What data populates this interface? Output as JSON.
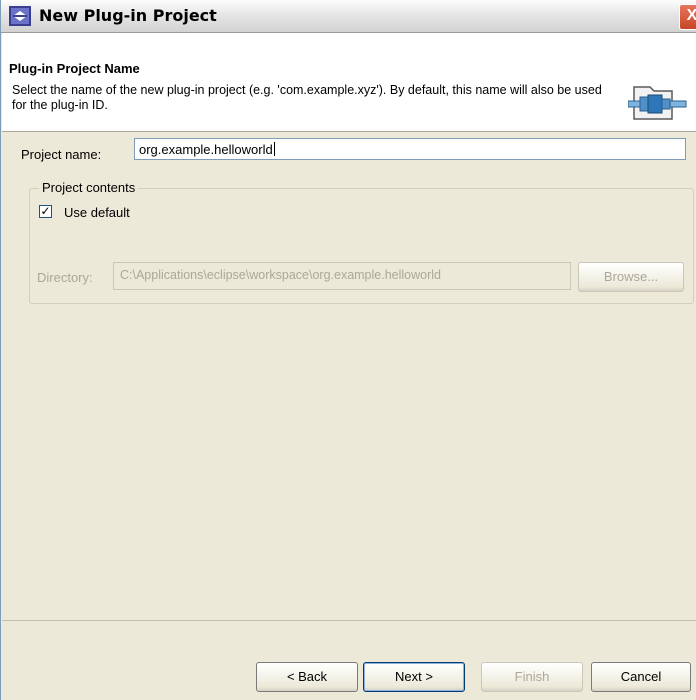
{
  "window": {
    "title": "New Plug-in Project",
    "close_symbol": "X"
  },
  "header": {
    "title": "Plug-in Project Name",
    "description": "Select the name of the new plug-in project (e.g. 'com.example.xyz'). By default, this name will also be used for the plug-in ID.",
    "icon": "plugin-project-wizard-icon"
  },
  "project_name": {
    "label": "Project name:",
    "value": "org.example.helloworld"
  },
  "project_contents": {
    "group_title": "Project contents",
    "use_default_label": "Use default",
    "use_default_checked": true,
    "directory_label": "Directory:",
    "directory_value": "C:\\Applications\\eclipse\\workspace\\org.example.helloworld",
    "browse_label": "Browse..."
  },
  "buttons": {
    "back": "< Back",
    "next": "Next >",
    "finish": "Finish",
    "cancel": "Cancel"
  },
  "colors": {
    "dialog_background": "#ece9d8",
    "header_background": "#ffffff",
    "disabled_text": "#aca899",
    "input_border": "#7f9db9"
  }
}
